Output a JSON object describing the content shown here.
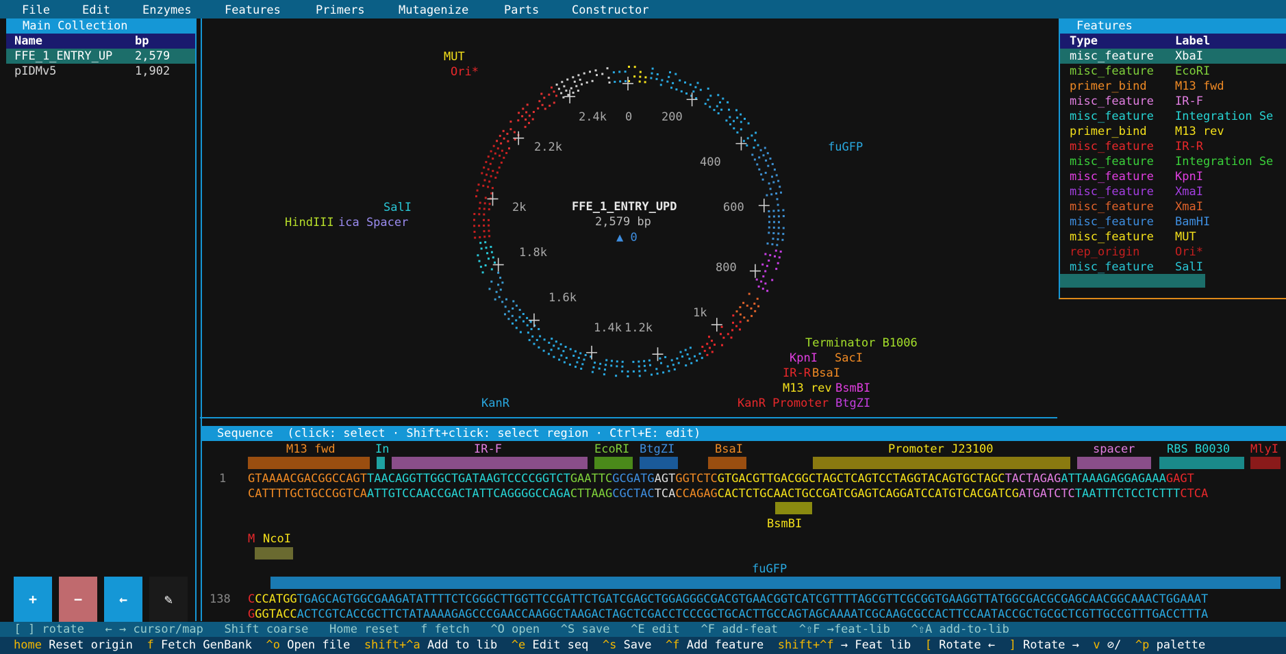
{
  "menu": [
    "File",
    "Edit",
    "Enzymes",
    "Features",
    "Primers",
    "Mutagenize",
    "Parts",
    "Constructor"
  ],
  "collection": {
    "title": "Main Collection",
    "headers": {
      "name": "Name",
      "bp": "bp"
    },
    "rows": [
      {
        "name": "FFE_1_ENTRY_UP",
        "bp": "2,579"
      },
      {
        "name": "pIDMv5",
        "bp": "1,902"
      }
    ],
    "buttons": {
      "add": "+",
      "remove": "−",
      "back": "←",
      "edit": "✎"
    }
  },
  "map": {
    "name": "FFE_1_ENTRY_UPD",
    "length": "2,579 bp",
    "origin": "▲ 0",
    "ticks": [
      "0",
      "200",
      "400",
      "600",
      "800",
      "1k",
      "1.2k",
      "1.4k",
      "1.6k",
      "1.8k",
      "2k",
      "2.2k",
      "2.4k"
    ],
    "labels": {
      "mut": "MUT",
      "ori": "Ori*",
      "fugfp": "fuGFP",
      "sali": "SalI",
      "hindiii": "HindIII",
      "spacer": "ica Spacer",
      "terminator": "Terminator B1006",
      "kpni": "KpnI",
      "saci": "SacI",
      "irr": "IR-R",
      "bsai": "BsaI",
      "m13rev": "M13 rev",
      "bsmbi": "BsmBI",
      "kanr_promoter": "KanR Promoter",
      "btgzi": "BtgZI",
      "kanr": "KanR"
    }
  },
  "features": {
    "title": "Features",
    "headers": {
      "type": "Type",
      "label": "Label"
    },
    "rows": [
      {
        "type": "misc_feature",
        "label": "XbaI",
        "color": "#ffffff"
      },
      {
        "type": "misc_feature",
        "label": "EcoRI",
        "color": "#7fd13b"
      },
      {
        "type": "primer_bind",
        "label": "M13 fwd",
        "color": "#f08a24"
      },
      {
        "type": "misc_feature",
        "label": "IR-F",
        "color": "#e27ee2"
      },
      {
        "type": "misc_feature",
        "label": "Integration Se",
        "color": "#27d4d4"
      },
      {
        "type": "primer_bind",
        "label": "M13 rev",
        "color": "#f5e11b"
      },
      {
        "type": "misc_feature",
        "label": "IR-R",
        "color": "#e8282b"
      },
      {
        "type": "misc_feature",
        "label": "Integration Se",
        "color": "#3ad13a"
      },
      {
        "type": "misc_feature",
        "label": "KpnI",
        "color": "#e03ee0"
      },
      {
        "type": "misc_feature",
        "label": "XmaI",
        "color": "#a33ee0"
      },
      {
        "type": "misc_feature",
        "label": "XmaI",
        "color": "#e0622a"
      },
      {
        "type": "misc_feature",
        "label": "BamHI",
        "color": "#3e8ee0"
      },
      {
        "type": "misc_feature",
        "label": "MUT",
        "color": "#f5e11b"
      },
      {
        "type": "rep_origin",
        "label": "Ori*",
        "color": "#c51f1f"
      },
      {
        "type": "misc_feature",
        "label": "SalI",
        "color": "#29c6d6"
      }
    ]
  },
  "sequence": {
    "title": "Sequence  (click: select · Shift+click: select region · Ctrl+E: edit)",
    "line1_num": "1",
    "line1_top": [
      "GTAAAACGACGGCCAGT",
      "TAACAGGTTGGCTGATAAGTCCCCGGTCT",
      "GAATTC",
      "GCGATG",
      "AGT",
      "GGTCTC",
      "GTGACGTTGACGGCTAGCTCAGTCCTAGGTACAGTGCTAGC",
      "TACTAGAG",
      "ATTAAAGAGGAGAAA",
      "GAGT"
    ],
    "line1_bot": [
      "CATTTTGCTGCCGGTCA",
      "ATTGTCCAACCGACTATTCAGGGGCCAGA",
      "CTTAAG",
      "CGCTAC",
      "TCA",
      "CCAGAG",
      "CACTCTGCAACTGCCGATCGAGTCAGGATCCATGTCACGATCG",
      "ATGATCTC",
      "TAATTTCTCCTCTTT",
      "CTCA"
    ],
    "line2_num": "138",
    "line2_top": [
      "C",
      "CCATGG",
      "TGAGCAGTGGCGAAGATATTTTCTCGGGCTTGGTTCCGATTCTGATCGAGCTGGAGGGCGACGTGAACGGTCATCGTTTTAGCGTTCGCGGTGAAGGTTATGGCGACGCGAGCAACGGCAAACTGGAAAT"
    ],
    "line2_bot": [
      "G",
      "GGTACC",
      "ACTCGTCACCGCTTCTATAAAAGAGCCCGAACCAAGGCTAAGACTAGCTCGACCTCCCGCTGCACTTGCCAGTAGCAAAATCGCAAGCGCCACTTCCAATACCGCTGCGCTCGTTGCCGTTTGACCTTTA"
    ],
    "feat_labels": {
      "m13fwd": "M13 fwd",
      "in": "In",
      "irf": "IR-F",
      "ecori": "EcoRI",
      "btgzi": "BtgZI",
      "bsai": "BsaI",
      "promoter": "Promoter J23100",
      "spacer": "spacer",
      "rbs": "RBS B0030",
      "mlyi": "MlyI",
      "bsmbi": "BsmBI",
      "m": "M",
      "ncoi": "NcoI",
      "fugfp": "fuGFP"
    }
  },
  "footer1": "  [ ] rotate   ← → cursor/map   Shift coarse   Home reset   f fetch   ^O open   ^S save   ^E edit   ^F add-feat   ^⇧F →feat-lib   ^⇧A add-to-lib",
  "footer2": [
    {
      "k": "home",
      "d": " Reset origin  "
    },
    {
      "k": "f",
      "d": " Fetch GenBank  "
    },
    {
      "k": "^o",
      "d": " Open file  "
    },
    {
      "k": "shift+^a",
      "d": " Add to lib  "
    },
    {
      "k": "^e",
      "d": " Edit seq  "
    },
    {
      "k": "^s",
      "d": " Save  "
    },
    {
      "k": "^f",
      "d": " Add feature  "
    },
    {
      "k": "shift+^f",
      "d": " → Feat lib  "
    },
    {
      "k": "[",
      "d": " Rotate ←  "
    },
    {
      "k": "]",
      "d": " Rotate →  "
    },
    {
      "k": "v",
      "d": " ⊘/  "
    },
    {
      "k": "^p",
      "d": " palette"
    }
  ]
}
